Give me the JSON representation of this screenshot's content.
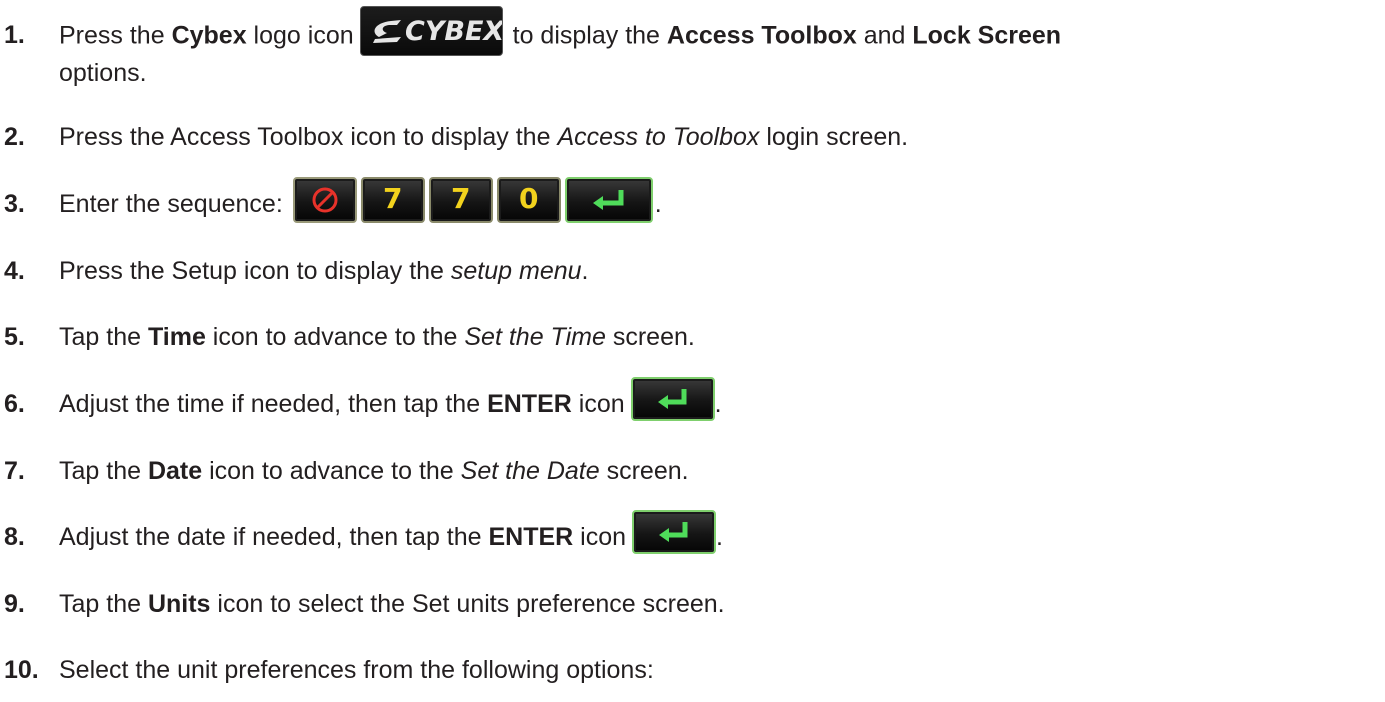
{
  "steps": [
    {
      "num": "1.",
      "parts": {
        "a": "Press the ",
        "b": "Cybex",
        "c": " logo icon",
        "d": "to display the ",
        "e": "Access Toolbox",
        "f": " and ",
        "g": "Lock Screen",
        "h": "options."
      },
      "logo_text": "CYBEX"
    },
    {
      "num": "2.",
      "parts": {
        "a": "Press the Access Toolbox icon to display the ",
        "b": "Access to Toolbox",
        "c": " login screen."
      }
    },
    {
      "num": "3.",
      "parts": {
        "a": "Enter the sequence:",
        "end": "."
      },
      "keys": [
        "7",
        "7",
        "0"
      ]
    },
    {
      "num": "4.",
      "parts": {
        "a": "Press the Setup icon to display the ",
        "b": "setup menu",
        "c": "."
      }
    },
    {
      "num": "5.",
      "parts": {
        "a": "Tap the ",
        "b": "Time",
        "c": " icon to advance to the ",
        "d": "Set the Time",
        "e": " screen."
      }
    },
    {
      "num": "6.",
      "parts": {
        "a": "Adjust the time if needed, then tap the ",
        "b": "ENTER",
        "c": " icon",
        "end": "."
      }
    },
    {
      "num": "7.",
      "parts": {
        "a": "Tap the ",
        "b": "Date",
        "c": " icon to advance to the ",
        "d": "Set the Date",
        "e": " screen."
      }
    },
    {
      "num": "8.",
      "parts": {
        "a": "Adjust the date if needed, then tap the ",
        "b": "ENTER",
        "c": " icon",
        "end": "."
      }
    },
    {
      "num": "9.",
      "parts": {
        "a": "Tap the ",
        "b": "Units",
        "c": " icon to select the Set units preference screen."
      }
    },
    {
      "num": "10.",
      "parts": {
        "a": "Select the unit preferences from the following options:"
      }
    }
  ],
  "icons": {
    "logo": "cybex-logo-icon",
    "clear": "clear-key-icon",
    "enter": "enter-icon"
  },
  "colors": {
    "text": "#231f20",
    "key_digit": "#f2d21d",
    "clear_symbol": "#e8322a",
    "enter_arrow": "#4fdc5a",
    "enter_border": "#7fcf6d"
  }
}
